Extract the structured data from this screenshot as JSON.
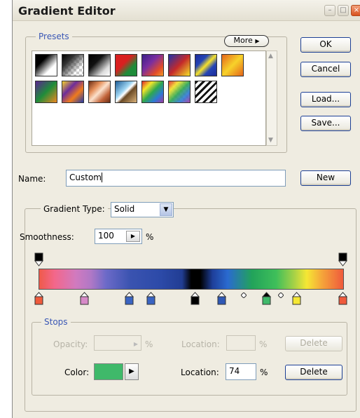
{
  "window": {
    "title": "Gradient Editor"
  },
  "presets": {
    "legend": "Presets",
    "more_label": "More",
    "swatches": [
      {
        "name": "black-white",
        "bg": "linear-gradient(135deg,#000 0%,#000 30%,#fff 70%,#fff 100%)"
      },
      {
        "name": "black-transparent",
        "bg": "linear-gradient(135deg,#000 0%,#333 30%,rgba(255,255,255,0) 75%),repeating-conic-gradient(#ccc 0% 25%,#fff 0% 50%) 0 0/8px 8px"
      },
      {
        "name": "black-white-2",
        "bg": "linear-gradient(135deg,#000 0%,#111 35%,#ddd 75%,#fff 100%)"
      },
      {
        "name": "red-green",
        "bg": "linear-gradient(135deg,#d92020 0%,#d92020 40%,#1f8c3a 70%,#1f8c3a 100%)"
      },
      {
        "name": "violet-orange",
        "bg": "linear-gradient(135deg,#3b1f88 0%,#7a2ea0 40%,#e24c2a 75%,#f29b2a 100%)"
      },
      {
        "name": "blue-red-yellow",
        "bg": "linear-gradient(135deg,#2233a8 0%,#c42a2a 50%,#f4e32a 100%)"
      },
      {
        "name": "blue-yellow-blue",
        "bg": "linear-gradient(135deg,#1d2b9a 0%,#2445b5 30%,#f6e12a 50%,#2445b5 70%,#1d2b9a 100%)"
      },
      {
        "name": "orange-yellow-orange",
        "bg": "linear-gradient(135deg,#e5651a 0%,#f7d22a 50%,#e5651a 100%)"
      },
      {
        "name": "violet-green-orange",
        "bg": "linear-gradient(135deg,#5a2590 0%,#1f8c3a 50%,#f0881f 100%)"
      },
      {
        "name": "yellow-violet-orange-blue",
        "bg": "linear-gradient(135deg,#f5d22a 0%,#6d2d9b 35%,#ef7b1d 65%,#2339a8 100%)"
      },
      {
        "name": "copper",
        "bg": "linear-gradient(135deg,#6b2d14 0%,#e58f5a 30%,#fbe1cc 50%,#c2643a 75%,#6b2d14 100%)"
      },
      {
        "name": "chrome",
        "bg": "linear-gradient(135deg,#1b5c97 0%,#9fd5f2 40%,#fff 50%,#6b4a25 60%,#d9b27a 100%)"
      },
      {
        "name": "spectrum",
        "bg": "linear-gradient(135deg,#e3262a 0%,#f2e52a 25%,#2fa84f 50%,#2d79d6 75%,#a03aa0 100%)"
      },
      {
        "name": "transparent-rainbow",
        "bg": "linear-gradient(135deg,rgba(227,38,42,.9) 0%,rgba(242,229,42,.9) 25%,rgba(47,168,79,.9) 50%,rgba(45,121,214,.9) 75%,rgba(160,58,160,.9) 100%),repeating-conic-gradient(#ccc 0% 25%,#fff 0% 50%) 0 0/8px 8px"
      },
      {
        "name": "transparent-stripes",
        "bg": "repeating-linear-gradient(135deg,#111 0 3px,#fff 3px 7px)"
      }
    ]
  },
  "buttons": {
    "ok": "OK",
    "cancel": "Cancel",
    "load": "Load...",
    "save": "Save...",
    "new": "New"
  },
  "name": {
    "label": "Name:",
    "value": "Custom"
  },
  "gradient": {
    "type_label": "Gradient Type:",
    "type_value": "Solid",
    "smoothness_label": "Smoothness:",
    "smoothness_value": "100",
    "smoothness_unit": "%",
    "bar_colors": "linear-gradient(90deg,#ef5a4a 0%,#f3678a 5%,#d17abf 12%,#b078c6 17%,#6c6ac8 22%,#3a53b0 30%,#2c4aa8 40%,#213d93 47%,#000 50%,#000 53%,#1e3f9a 57%,#2a6ad0 62%,#22a35a 70%,#3fbf5a 78%,#a9d246 84%,#f5e734 88%,#f5a53a 93%,#ef5a3c 100%)"
  },
  "stops": {
    "legend": "Stops",
    "opacity_label": "Opacity:",
    "opacity_unit": "%",
    "location_label": "Location:",
    "location_unit": "%",
    "delete_label": "Delete",
    "color_label": "Color:",
    "color_value": "#3fb96a",
    "color_location_label": "Location:",
    "color_location_value": "74",
    "color_location_unit": "%",
    "delete2_label": "Delete",
    "opacity_stop_count": 2,
    "color_stops": [
      {
        "color": "#ef5a3c"
      },
      {
        "color": "#d78ac8"
      },
      {
        "color": "#3a64c2"
      },
      {
        "color": "#3a64c2"
      },
      {
        "color": "#000000"
      },
      {
        "color": "#2f58b5"
      },
      {
        "color": "#3fb96a",
        "selected": true
      },
      {
        "color": "#f5e734"
      },
      {
        "color": "#ef5a3c"
      }
    ]
  }
}
